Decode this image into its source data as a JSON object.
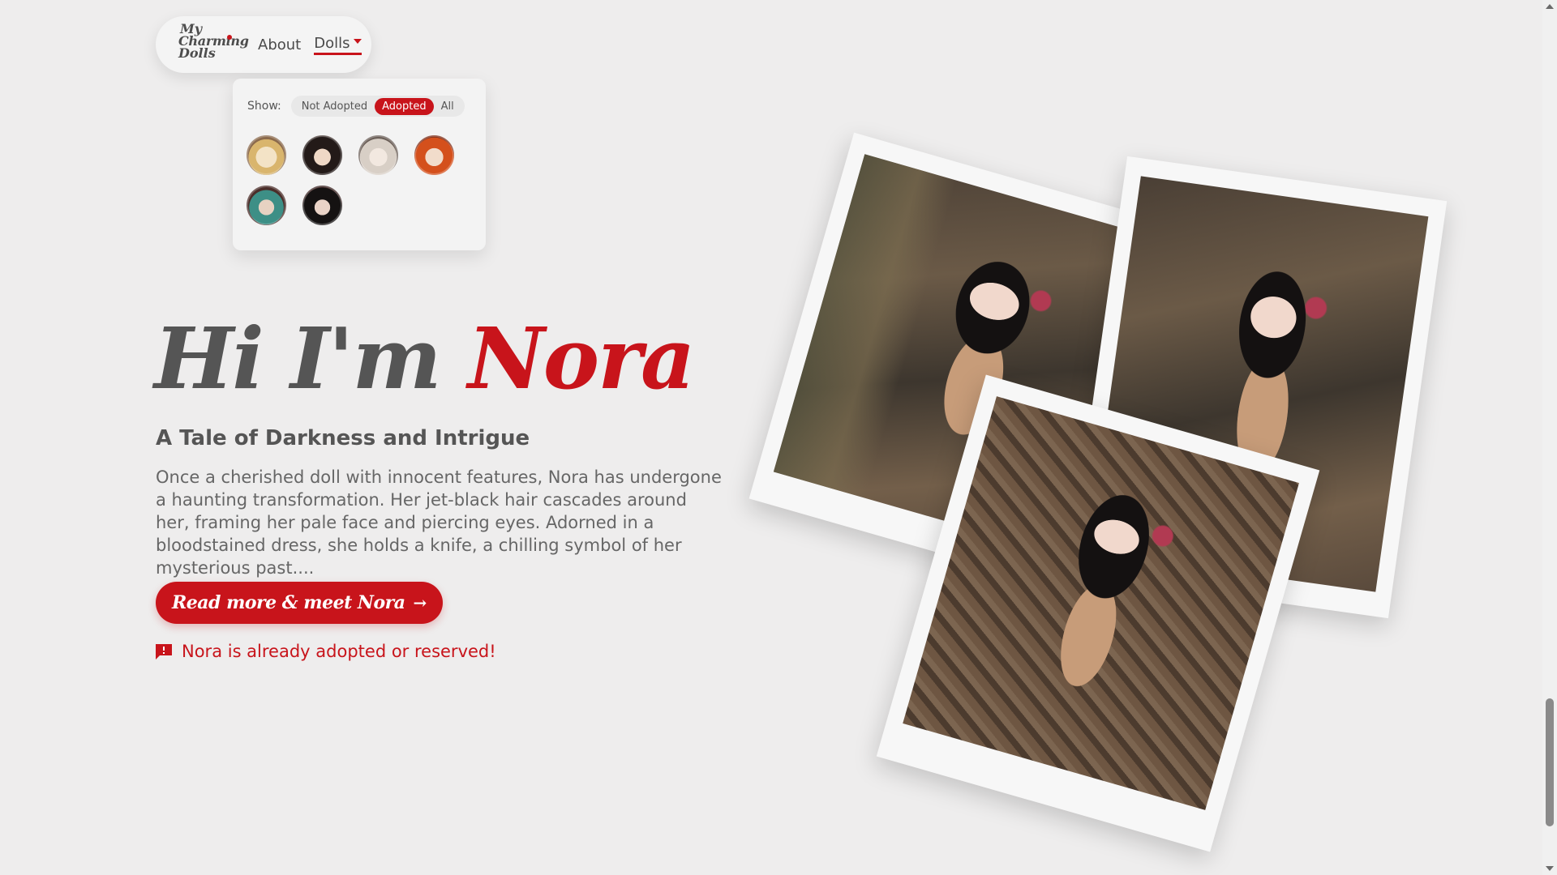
{
  "brand": {
    "logo_line1": "My",
    "logo_line2": "Charming",
    "logo_line3": "Dolls"
  },
  "nav": {
    "about": "About",
    "dolls": "Dolls"
  },
  "dropdown": {
    "show_label": "Show:",
    "filters": [
      "Not Adopted",
      "Adopted",
      "All"
    ],
    "active_filter": "Adopted",
    "doll_avatar_count": 6
  },
  "hero": {
    "greeting": "Hi I'm ",
    "name": "Nora",
    "subtitle": "A Tale of Darkness and Intrigue",
    "description": "Once a cherished doll with innocent features, Nora has undergone a haunting transformation. Her jet-black hair cascades around her, framing her pale face and piercing eyes. Adorned in a bloodstained dress, she holds a knife, a chilling symbol of her mysterious past....",
    "cta_label": "Read more & meet Nora",
    "cta_arrow": "→",
    "notice": "Nora is already adopted or reserved!"
  },
  "colors": {
    "accent": "#c8141b",
    "text": "#555555",
    "background": "#eeeded"
  },
  "icons": {
    "notice": "flag-alert-icon",
    "cta": "arrow-right-icon",
    "dolls_menu": "chevron-down-icon"
  }
}
